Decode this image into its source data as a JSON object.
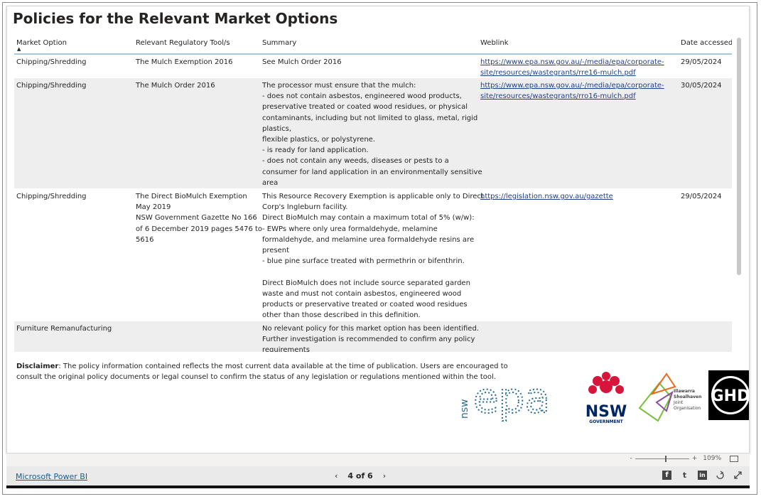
{
  "report": {
    "title": "Policies for the Relevant Market Options"
  },
  "table": {
    "headers": [
      "Market Option",
      "Relevant Regulatory Tool/s",
      "Summary",
      "Weblink",
      "Date accessed"
    ],
    "rows": [
      {
        "market_option": "Chipping/Shredding",
        "tool": [
          "The Mulch Exemption 2016"
        ],
        "summary": [
          "See Mulch Order 2016"
        ],
        "weblink": [
          "https://www.epa.nsw.gov.au/-/media/epa/corporate-",
          "site/resources/wastegrants/rre16-mulch.pdf"
        ],
        "date": "29/05/2024"
      },
      {
        "market_option": "Chipping/Shredding",
        "tool": [
          "The Mulch Order 2016"
        ],
        "summary": [
          "The processor must ensure that the mulch:",
          "- does not contain asbestos, engineered wood products,",
          "preservative treated or coated wood residues, or physical",
          "contaminants, including but not limited to glass, metal, rigid",
          "plastics,",
          "flexible plastics, or polystyrene.",
          "- is ready for land application.",
          "- does not contain any weeds, diseases or pests to a",
          "consumer for land application in an environmentally sensitive",
          "area"
        ],
        "weblink": [
          "https://www.epa.nsw.gov.au/-/media/epa/corporate-",
          "site/resources/wastegrants/rro16-mulch.pdf"
        ],
        "date": "30/05/2024"
      },
      {
        "market_option": "Chipping/Shredding",
        "tool": [
          "The Direct BioMulch Exemption",
          "May 2019",
          "NSW Government Gazette No 166",
          "of 6 December 2019 pages 5476 to",
          "5616"
        ],
        "summary": [
          "This Resource Recovery Exemption is applicable only to Direct",
          "Corp's Ingleburn facility.",
          "Direct BioMulch may contain a maximum total of 5% (w/w):",
          "- EWPs where only urea formaldehyde, melamine",
          "formaldehyde, and melamine urea formaldehyde resins are",
          "present",
          "- blue pine surface treated with permethrin or bifenthrin.",
          "",
          "Direct BioMulch does not include source separated garden",
          "waste and must not contain asbestos, engineered wood",
          "products or preservative treated or coated wood residues",
          "other than those described in this definition."
        ],
        "weblink": [
          "https://legislation.nsw.gov.au/gazette"
        ],
        "date": "29/05/2024"
      },
      {
        "market_option": "Furniture Remanufacturing",
        "tool": [],
        "summary": [
          "No relevant policy for this market option has been identified.",
          "Further investigation is recommended to confirm any policy",
          "requirements"
        ],
        "weblink": [],
        "date": ""
      }
    ]
  },
  "disclaimer": {
    "label": "Disclaimer",
    "text": ": The policy information contained reflects the most current data available at the time of publication. Users are encouraged to consult the original policy documents or legal counsel to confirm the status of any legislation or regulations mentioned within the tool."
  },
  "logos": {
    "epa_prefix": "nsw",
    "epa_word": "epa",
    "nsw_main": "NSW",
    "nsw_sub": "GOVERNMENT",
    "illawarra": [
      "Illawarra",
      "Shoalhaven",
      "Joint",
      "Organisation"
    ],
    "ghd": "GHD"
  },
  "zoom": {
    "minus": "-",
    "plus": "+",
    "level": "109%"
  },
  "footer": {
    "brand_link": "Microsoft Power BI",
    "page_indicator": "4 of 6",
    "prev": "‹",
    "next": "›"
  },
  "icons": {
    "facebook": "f",
    "twitter": "t",
    "linkedin": "in",
    "share": "share-icon",
    "expand": "expand-icon"
  },
  "colors": {
    "link": "#1e3f8a",
    "header_rule": "#a9c6e0",
    "alt_row": "#eeeeee",
    "nsw_red": "#d7153a",
    "nsw_navy": "#002664",
    "epa_blue": "#2a6b8f"
  }
}
